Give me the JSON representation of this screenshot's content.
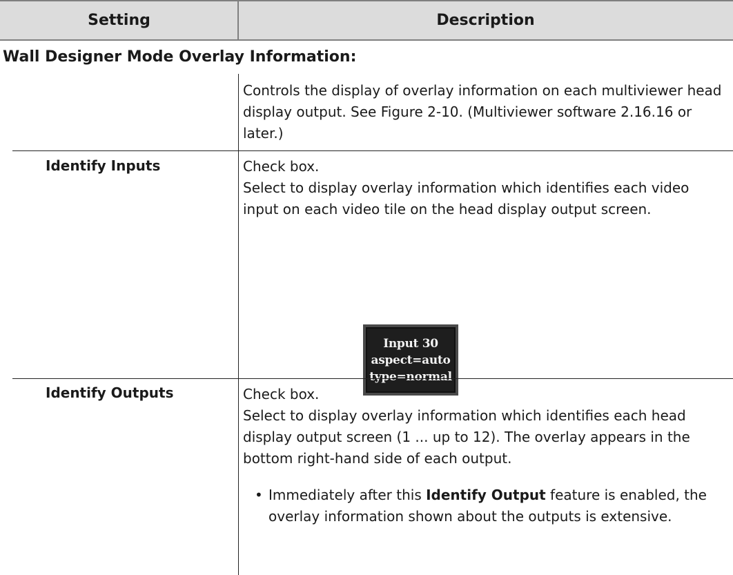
{
  "table": {
    "header": {
      "setting": "Setting",
      "description": "Description"
    },
    "section_heading": "Wall Designer Mode Overlay Information:",
    "section_intro": "Controls the display of overlay information on each multiviewer head display output. See Figure 2-10. (Multiviewer software 2.16.16 or later.)",
    "rows": [
      {
        "setting": "Identify Inputs",
        "description_lines": [
          "Check box.",
          "Select to display overlay information which identifies each video input on each video tile on the head display output screen."
        ],
        "overlay_image": {
          "lines": [
            "Input 30",
            "aspect=auto",
            "type=normal"
          ]
        }
      },
      {
        "setting": "Identify Outputs",
        "description_lines": [
          "Check box.",
          "Select to display overlay information which identifies each head display output screen (1 ... up to 12). The overlay appears in the bottom right-hand side of each output."
        ],
        "bullet": {
          "before": "Immediately after this ",
          "bold": "Identify Output",
          "after": " feature is enabled, the overlay information shown about the outputs is extensive."
        }
      }
    ]
  }
}
